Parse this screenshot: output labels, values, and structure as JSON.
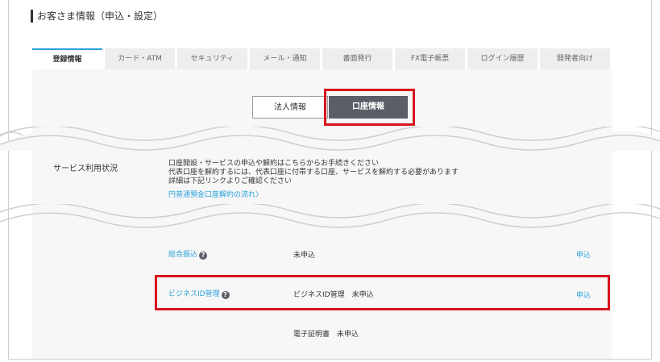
{
  "page_title": "お客さま情報（申込・設定）",
  "tabs": [
    {
      "label": "登録情報",
      "active": true
    },
    {
      "label": "カード・ATM"
    },
    {
      "label": "セキュリティ"
    },
    {
      "label": "メール・通知"
    },
    {
      "label": "書面発行"
    },
    {
      "label": "FX電子帳票"
    },
    {
      "label": "ログイン履歴"
    },
    {
      "label": "開発者向け"
    }
  ],
  "segment": {
    "corporate_label": "法人情報",
    "account_label": "口座情報",
    "selected": "口座情報"
  },
  "service": {
    "label": "サービス利用状況",
    "lines": [
      "口座開設・サービスの申込や解約はこちらからお手続きください",
      "代表口座を解約するには、代表口座に付帯する口座、サービスを解約する必要があります",
      "詳細は下記リンクよりご確認ください"
    ],
    "link": "円普通預金口座解約の流れ〉"
  },
  "rows": [
    {
      "name": "総合振込",
      "help": "?",
      "status": "未申込",
      "action": "申込"
    },
    {
      "name": "ビジネスID管理",
      "help": "?",
      "status": "ビジネスID管理　未申込",
      "action": "申込"
    },
    {
      "status": "電子証明書　未申込"
    }
  ],
  "colors": {
    "accent": "#2aa1d9",
    "highlight": "#d6141c",
    "selected_segment": "#5a5e66"
  }
}
